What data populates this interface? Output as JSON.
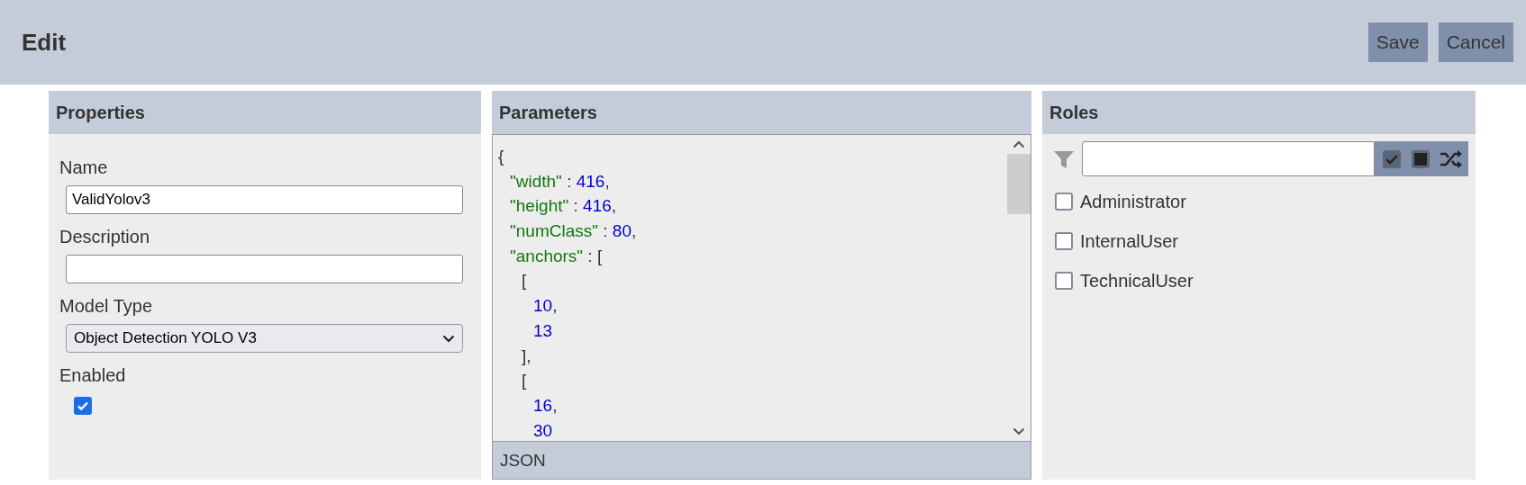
{
  "header": {
    "title": "Edit",
    "buttons": [
      "Save",
      "Cancel"
    ]
  },
  "properties": {
    "title": "Properties",
    "name": {
      "label": "Name",
      "value": "ValidYolov3"
    },
    "description": {
      "label": "Description"
    },
    "model_type": {
      "label": "Model Type",
      "value": "Object Detection YOLO V3"
    },
    "enabled": {
      "label": "Enabled",
      "checked": true
    }
  },
  "parameters": {
    "title": "Parameters",
    "footer": "JSON",
    "lines": [
      {
        "tokens": [
          {
            "kind": "punct",
            "text": "{"
          }
        ],
        "children": [
          {
            "tokens": [
              {
                "kind": "key",
                "text": "\"width\""
              },
              {
                "kind": "punct",
                "text": " : "
              },
              {
                "kind": "number",
                "text": "416"
              },
              {
                "kind": "punct",
                "text": ","
              }
            ]
          },
          {
            "tokens": [
              {
                "kind": "key",
                "text": "\"height\""
              },
              {
                "kind": "punct",
                "text": " : "
              },
              {
                "kind": "number",
                "text": "416"
              },
              {
                "kind": "punct",
                "text": ","
              }
            ]
          },
          {
            "tokens": [
              {
                "kind": "key",
                "text": "\"numClass\""
              },
              {
                "kind": "punct",
                "text": " : "
              },
              {
                "kind": "number",
                "text": "80"
              },
              {
                "kind": "punct",
                "text": ","
              }
            ]
          },
          {
            "tokens": [
              {
                "kind": "key",
                "text": "\"anchors\""
              },
              {
                "kind": "punct",
                "text": " : ["
              }
            ],
            "children": [
              {
                "tokens": [
                  {
                    "kind": "punct",
                    "text": "["
                  }
                ],
                "children": [
                  {
                    "tokens": [
                      {
                        "kind": "number",
                        "text": "10"
                      },
                      {
                        "kind": "punct",
                        "text": ","
                      }
                    ]
                  },
                  {
                    "tokens": [
                      {
                        "kind": "number",
                        "text": "13"
                      }
                    ]
                  }
                ]
              },
              {
                "tokens": [
                  {
                    "kind": "punct",
                    "text": "],"
                  }
                ]
              },
              {
                "tokens": [
                  {
                    "kind": "punct",
                    "text": "["
                  }
                ],
                "children": [
                  {
                    "tokens": [
                      {
                        "kind": "number",
                        "text": "16"
                      },
                      {
                        "kind": "punct",
                        "text": ","
                      }
                    ]
                  },
                  {
                    "tokens": [
                      {
                        "kind": "number",
                        "text": "30"
                      }
                    ]
                  }
                ]
              }
            ]
          }
        ]
      }
    ]
  },
  "roles": {
    "title": "Roles",
    "items": [
      {
        "label": "Administrator",
        "checked": false
      },
      {
        "label": "InternalUser",
        "checked": false
      },
      {
        "label": "TechnicalUser",
        "checked": false
      }
    ]
  }
}
